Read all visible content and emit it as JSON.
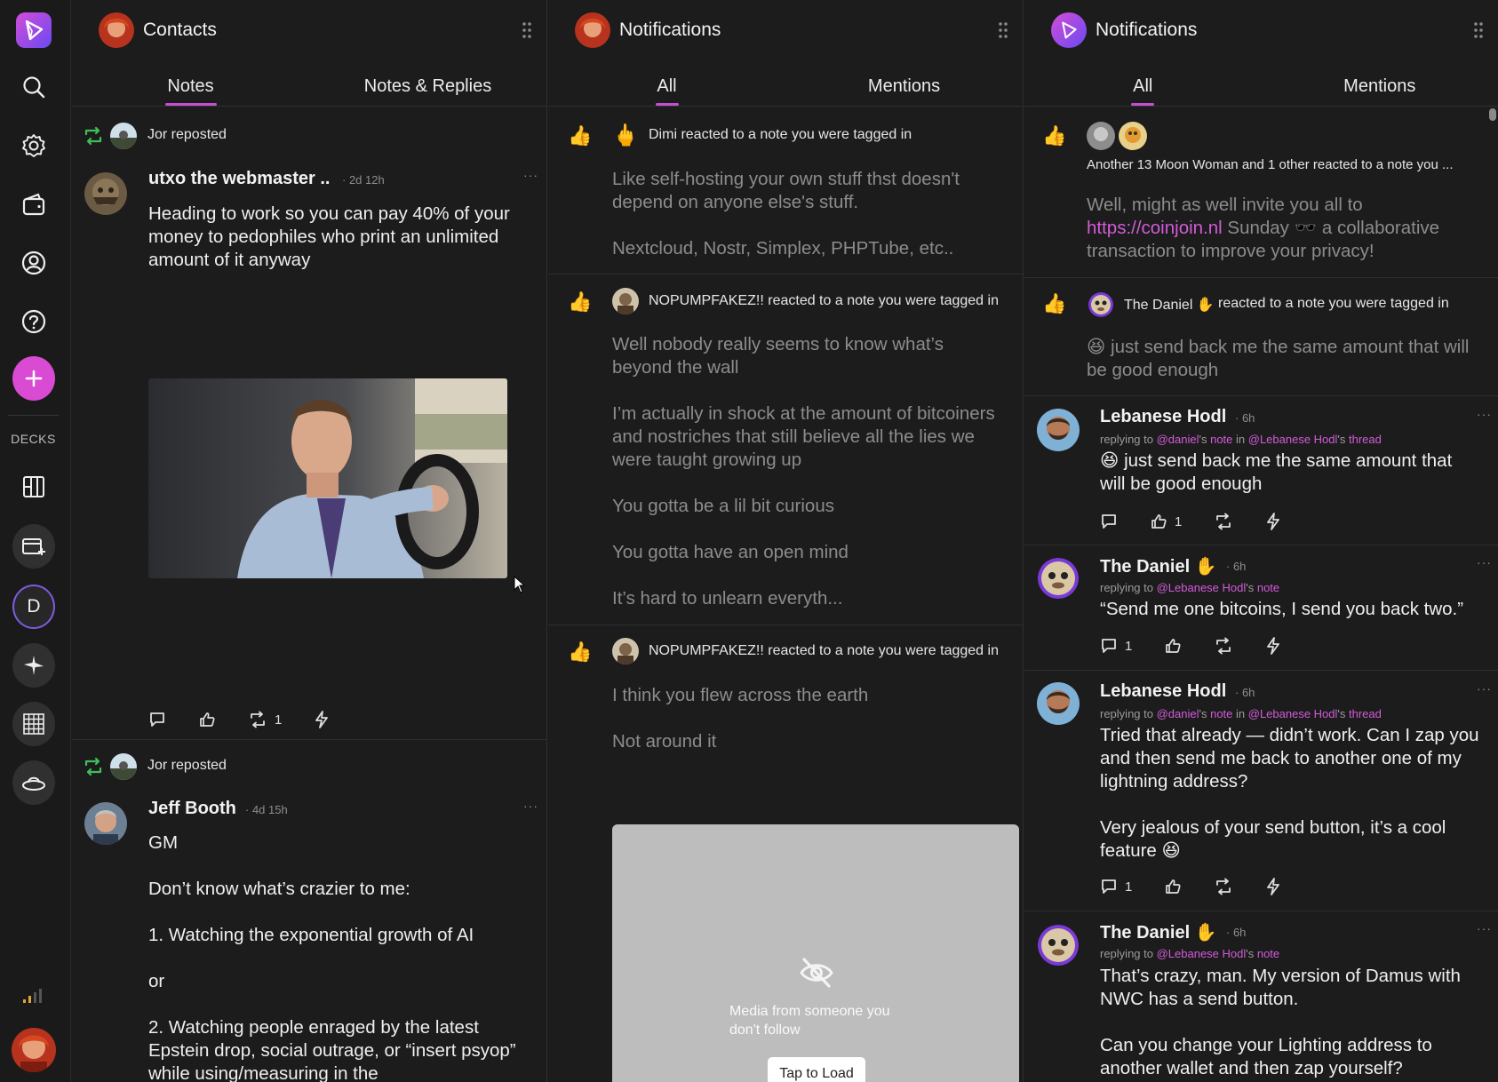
{
  "sidebar": {
    "decks_label": "DECKS",
    "deck_d_label": "D"
  },
  "columns": [
    {
      "title": "Contacts",
      "tabs": [
        "Notes",
        "Notes & Replies"
      ],
      "active_tab": 0,
      "items": [
        {
          "repost_label": "Jor reposted",
          "author": "utxo the webmaster ..",
          "time": "· 2d 12h",
          "body": "Heading to work so you can pay 40% of your money to pedophiles who print an unlimited amount of it anyway",
          "repost_count": "1"
        },
        {
          "repost_label": "Jor reposted",
          "author": "Jeff Booth",
          "time": "· 4d 15h",
          "lines": [
            "GM",
            "Don’t know what’s crazier to me:",
            "1. Watching the exponential growth of AI",
            "or",
            "2. Watching people enraged by the latest Epstein drop, social outrage, or “insert psyop” while using/measuring in the"
          ]
        }
      ]
    },
    {
      "title": "Notifications",
      "tabs": [
        "All",
        "Mentions"
      ],
      "active_tab": 0,
      "items": [
        {
          "line": "Dimi reacted to a note you were tagged in",
          "paras": [
            "Like self-hosting your own stuff thst doesn't depend on anyone else's stuff.",
            "Nextcloud, Nostr, Simplex, PHPTube, etc.."
          ]
        },
        {
          "line": "NOPUMPFAKEZ!! reacted to a note you were tagged in",
          "paras": [
            "Well nobody really seems to know what’s beyond the wall",
            "I’m actually in shock at the amount of bitcoiners and nostriches that still believe all the lies we were taught growing up",
            "You gotta be a lil bit curious",
            "You gotta have an open mind",
            "It’s hard to unlearn everyth..."
          ]
        },
        {
          "line": "NOPUMPFAKEZ!! reacted to a note you were tagged in",
          "paras": [
            "I think you flew across the earth",
            "Not around it"
          ],
          "media_notice": "Media from someone you don't follow",
          "tap_to_load": "Tap to Load"
        }
      ]
    },
    {
      "title": "Notifications",
      "tabs": [
        "All",
        "Mentions"
      ],
      "active_tab": 0,
      "items": [
        {
          "line": "Another 13 Moon Woman  and 1 other reacted to a note you ...",
          "text_before": "Well, might as well invite you all to ",
          "link": "https://coinjoin.nl",
          "text_after": " Sunday 🕶️ a collaborative transaction to improve your privacy!"
        },
        {
          "line_name": "The Daniel ✋",
          "line_rest": "reacted to a note you were tagged in",
          "body": "😆 just send back me the same amount that will be good enough"
        },
        {
          "author": "Lebanese Hodl",
          "time": "· 6h",
          "reply": {
            "prefix": "replying to ",
            "user1": "@daniel",
            "mid1": "'s ",
            "note": "note",
            "mid2": " in ",
            "user2": "@Lebanese Hodl",
            "mid3": "'s ",
            "thread": "thread"
          },
          "body": "😆 just send back me the same amount that will be good enough",
          "like_count": "1"
        },
        {
          "author": "The Daniel ✋",
          "time": "· 6h",
          "reply": {
            "prefix": "replying to ",
            "user1": "@Lebanese Hodl",
            "mid1": "'s ",
            "note": "note"
          },
          "body": "“Send me one bitcoins, I send you back two.”",
          "reply_count": "1"
        },
        {
          "author": "Lebanese Hodl",
          "time": "· 6h",
          "reply": {
            "prefix": "replying to ",
            "user1": "@daniel",
            "mid1": "'s ",
            "note": "note",
            "mid2": " in ",
            "user2": "@Lebanese Hodl",
            "mid3": "'s ",
            "thread": "thread"
          },
          "body1": "Tried that already — didn’t work. Can I zap you and then send me back to another one of my lightning address?",
          "body2": "Very jealous of your send button, it’s a cool feature 😆",
          "reply_count": "1"
        },
        {
          "author": "The Daniel ✋",
          "time": "· 6h",
          "reply": {
            "prefix": "replying to ",
            "user1": "@Lebanese Hodl",
            "mid1": "'s ",
            "note": "note"
          },
          "body1": "That’s crazy, man. My version of Damus with NWC has a send button.",
          "body2": "Can you change your Lighting address to another wallet and then zap yourself?"
        }
      ]
    }
  ],
  "colors": {
    "accent": "#c64fd1",
    "repost_green": "#3fbf5a",
    "background": "#1c1c1c"
  }
}
